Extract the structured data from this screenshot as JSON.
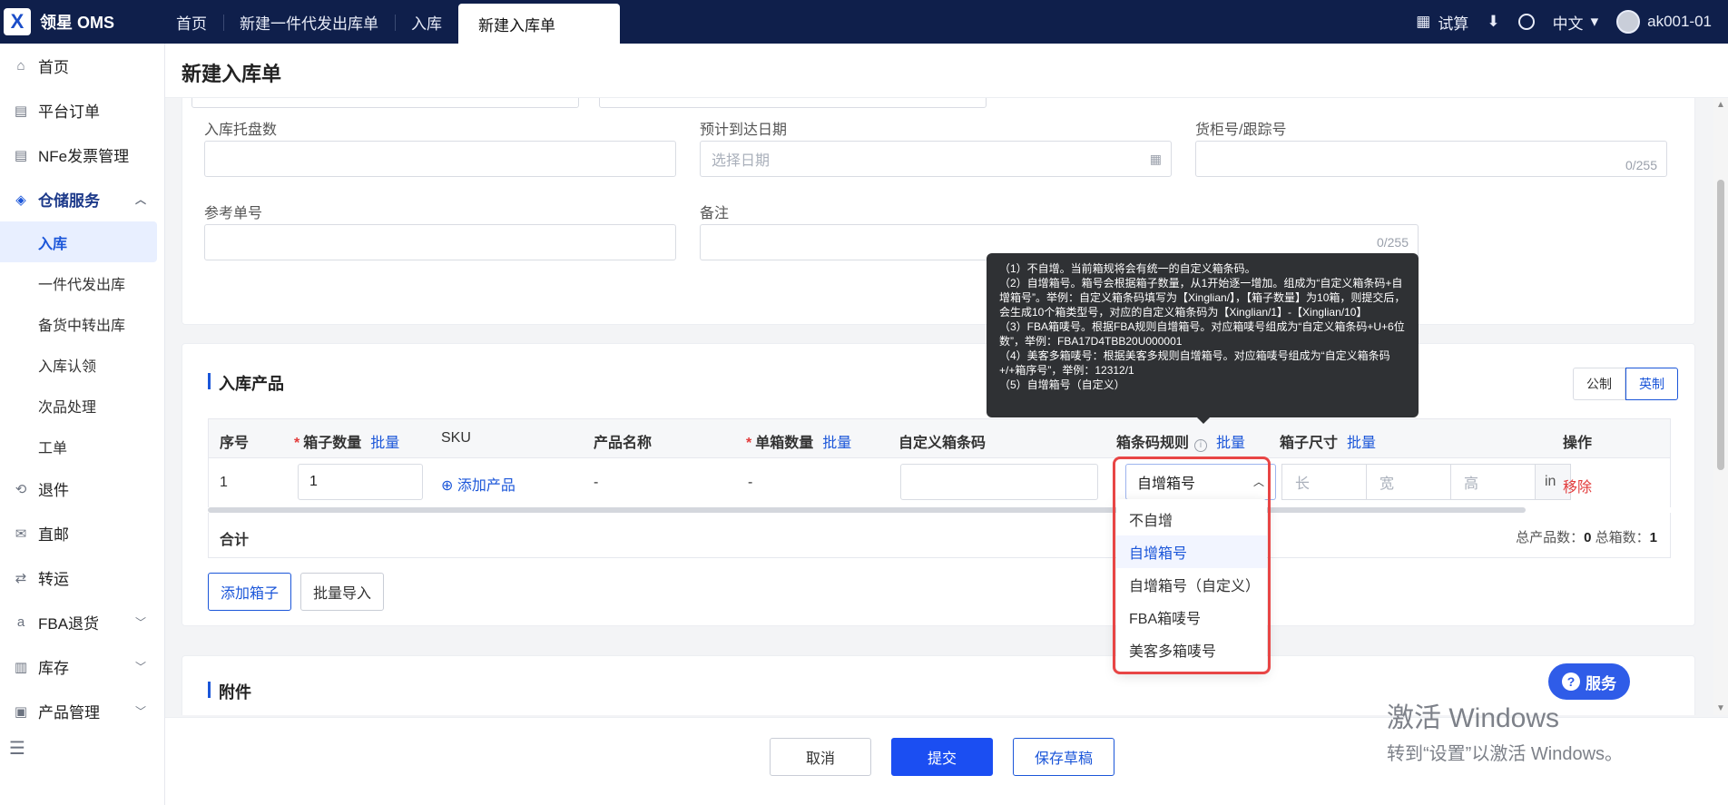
{
  "app": {
    "logo_mark": "X",
    "name": "领星 OMS"
  },
  "tabs": [
    {
      "label": "首页"
    },
    {
      "label": "新建一件代发出库单"
    },
    {
      "label": "入库"
    },
    {
      "label": "新建入库单"
    }
  ],
  "topbar": {
    "trial_label": "试算",
    "language": "中文",
    "username": "ak001-01"
  },
  "sidebar": {
    "items": [
      {
        "label": "首页",
        "icon": "home-icon"
      },
      {
        "label": "平台订单",
        "icon": "clipboard-icon"
      },
      {
        "label": "NFe发票管理",
        "icon": "clipboard-icon"
      },
      {
        "label": "仓储服务",
        "icon": "warehouse-icon"
      },
      {
        "label": "退件",
        "icon": "return-icon"
      },
      {
        "label": "直邮",
        "icon": "mail-icon"
      },
      {
        "label": "转运",
        "icon": "transfer-icon"
      },
      {
        "label": "FBA退货",
        "icon": "amazon-icon"
      },
      {
        "label": "库存",
        "icon": "stock-icon"
      },
      {
        "label": "产品管理",
        "icon": "product-icon"
      }
    ],
    "sub_items": [
      "入库",
      "一件代发出库",
      "备货中转出库",
      "入库认领",
      "次品处理",
      "工单"
    ]
  },
  "page": {
    "title": "新建入库单"
  },
  "form": {
    "pallet_label": "入库托盘数",
    "eta_label": "预计到达日期",
    "eta_placeholder": "选择日期",
    "container_label": "货柜号/跟踪号",
    "container_counter": "0/255",
    "ref_label": "参考单号",
    "remark_label": "备注",
    "remark_counter": "0/255"
  },
  "products": {
    "section_title": "入库产品",
    "unit_metric": "公制",
    "unit_imperial": "英制",
    "columns": {
      "index": "序号",
      "box_qty": "箱子数量",
      "sku": "SKU",
      "name": "产品名称",
      "per_box": "单箱数量",
      "barcode": "自定义箱条码",
      "rule": "箱条码规则",
      "size": "箱子尺寸",
      "ops": "操作",
      "batch": "批量"
    },
    "row": {
      "index": "1",
      "box_qty": "1",
      "add_product": "添加产品",
      "name": "-",
      "per_box": "-",
      "rule_value": "自增箱号",
      "len_ph": "长",
      "wid_ph": "宽",
      "hei_ph": "高",
      "unit": "in",
      "remove": "移除"
    },
    "total_label": "合计",
    "total_products_label": "总产品数：",
    "total_products": "0",
    "total_boxes_label": "总箱数：",
    "total_boxes": "1",
    "add_box": "添加箱子",
    "batch_import": "批量导入"
  },
  "attachments": {
    "section_title": "附件"
  },
  "footer": {
    "cancel": "取消",
    "submit": "提交",
    "save_draft": "保存草稿"
  },
  "tooltip": {
    "lines": [
      "（1）不自增。当前箱规将会有统一的自定义箱条码。",
      "（2）自增箱号。箱号会根据箱子数量，从1开始逐一增加。组成为“自定义箱条码+自增箱号”。举例：自定义箱条码填写为【Xinglian/】，【箱子数量】为10箱，则提交后，会生成10个箱类型号，对应的自定义箱条码为【Xinglian/1】-【Xinglian/10】",
      "（3）FBA箱唛号。根据FBA规则自增箱号。对应箱唛号组成为“自定义箱条码+U+6位数”，举例：FBA17D4TBB20U000001",
      "（4）美客多箱唛号：根据美客多规则自增箱号。对应箱唛号组成为“自定义箱条码+/+箱序号”，举例：12312/1",
      "（5）自增箱号（自定义）"
    ]
  },
  "dropdown": {
    "options": [
      "不自增",
      "自增箱号",
      "自增箱号（自定义）",
      "FBA箱唛号",
      "美客多箱唛号"
    ],
    "selected_index": 1
  },
  "service_button": "服务",
  "watermark": {
    "line1": "激活 Windows",
    "line2": "转到“设置”以激活 Windows。"
  },
  "colors": {
    "topbar": "#0f1f4b",
    "accent": "#1b56d9",
    "danger": "#e23b3b",
    "highlight": "#e84545"
  }
}
